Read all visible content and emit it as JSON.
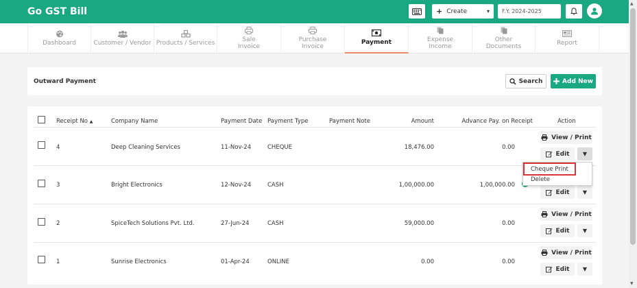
{
  "app": {
    "title": "Go GST Bill"
  },
  "header": {
    "create_label": "Create",
    "fy_value": "F.Y. 2024-2025"
  },
  "nav": {
    "items": [
      {
        "label": "Dashboard",
        "icon": "palette-icon"
      },
      {
        "label": "Customer / Vendor",
        "icon": "users-icon"
      },
      {
        "label": "Products / Services",
        "icon": "cubes-icon"
      },
      {
        "label": "Sale\nInvoice",
        "line1": "Sale",
        "line2": "Invoice",
        "icon": "printer-icon"
      },
      {
        "label": "Purchase\nInvoice",
        "line1": "Purchase",
        "line2": "Invoice",
        "icon": "printer-icon"
      },
      {
        "label": "Payment",
        "icon": "money-icon"
      },
      {
        "label": "Expense\nIncome",
        "line1": "Expense",
        "line2": "Income",
        "icon": "document-icon"
      },
      {
        "label": "Other\nDocuments",
        "line1": "Other",
        "line2": "Documents",
        "icon": "document-icon"
      },
      {
        "label": "Report",
        "icon": "report-icon"
      }
    ],
    "active": "Payment"
  },
  "section": {
    "title": "Outward Payment",
    "search_label": "Search",
    "add_label": "Add New"
  },
  "table": {
    "headers": {
      "receipt_no": "Receipt No",
      "company": "Company Name",
      "date": "Payment Date",
      "type": "Payment Type",
      "note": "Payment Note",
      "amount": "Amount",
      "advance": "Advance Pay. on Receipt",
      "action": "Action"
    },
    "sort_indicator": "▲",
    "rows": [
      {
        "receipt_no": "4",
        "company": "Deep Cleaning Services",
        "date": "11-Nov-24",
        "type": "CHEQUE",
        "note": "",
        "amount": "18,476.00",
        "advance": "0.00"
      },
      {
        "receipt_no": "3",
        "company": "Bright Electronics",
        "date": "12-Nov-24",
        "type": "CASH",
        "note": "",
        "amount": "1,00,000.00",
        "advance": "1,00,000.00"
      },
      {
        "receipt_no": "2",
        "company": "SpiceTech Solutions Pvt. Ltd.",
        "date": "27-Jun-24",
        "type": "CASH",
        "note": "",
        "amount": "59,000.00",
        "advance": "0.00"
      },
      {
        "receipt_no": "1",
        "company": "Sunrise Electronics",
        "date": "01-Apr-24",
        "type": "ONLINE",
        "note": "",
        "amount": "0.00",
        "advance": "0.00"
      }
    ],
    "view_label": "View / Print",
    "edit_label": "Edit"
  },
  "dropdown": {
    "items": [
      "Cheque Print",
      "Delete"
    ],
    "highlighted": "Cheque Print"
  },
  "colors": {
    "brand": "#1aa882",
    "highlight": "#d9343a",
    "active_tab_underline": "#e88a6a"
  }
}
